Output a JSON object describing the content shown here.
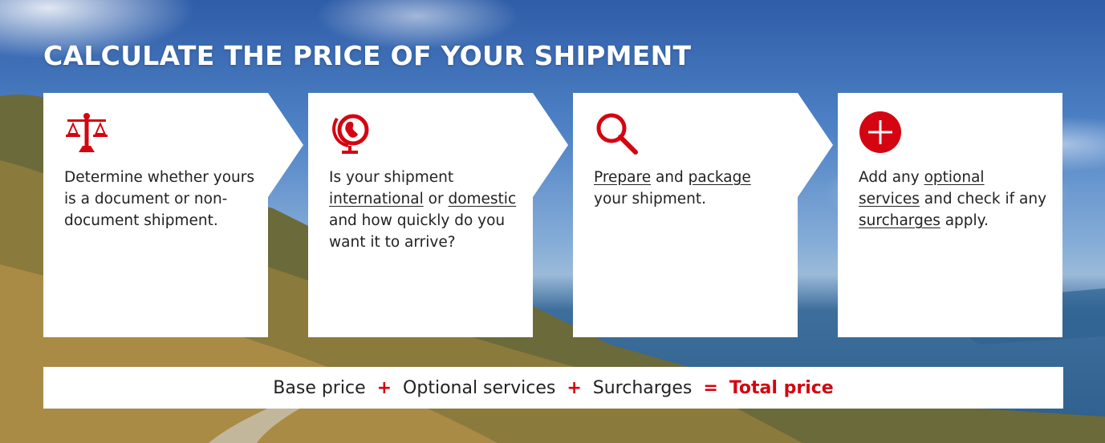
{
  "page": {
    "title": "CALCULATE THE PRICE OF YOUR SHIPMENT"
  },
  "colors": {
    "accent": "#d40511",
    "card_bg": "#ffffff",
    "text": "#222222"
  },
  "steps": [
    {
      "icon": "scales-icon",
      "segments": [
        {
          "text": "Determine whether yours is a document or non-document shipment.",
          "link": false
        }
      ]
    },
    {
      "icon": "globe-icon",
      "segments": [
        {
          "text": "Is your shipment ",
          "link": false
        },
        {
          "text": "international",
          "link": true
        },
        {
          "text": " or ",
          "link": false
        },
        {
          "text": "domestic",
          "link": true
        },
        {
          "text": " and how quickly do you want it to arrive?",
          "link": false
        }
      ]
    },
    {
      "icon": "search-icon",
      "segments": [
        {
          "text": "Prepare",
          "link": true
        },
        {
          "text": " and ",
          "link": false
        },
        {
          "text": "package",
          "link": true
        },
        {
          "text": " your shipment.",
          "link": false
        }
      ]
    },
    {
      "icon": "plus-circle-icon",
      "segments": [
        {
          "text": "Add any ",
          "link": false
        },
        {
          "text": "optional services",
          "link": true
        },
        {
          "text": " and check if any ",
          "link": false
        },
        {
          "text": "surcharges",
          "link": true
        },
        {
          "text": " apply.",
          "link": false
        }
      ]
    }
  ],
  "formula": {
    "base": "Base price",
    "plus1": "+",
    "optional": "Optional services",
    "plus2": "+",
    "surcharges": "Surcharges",
    "equals": "=",
    "total": "Total price"
  }
}
